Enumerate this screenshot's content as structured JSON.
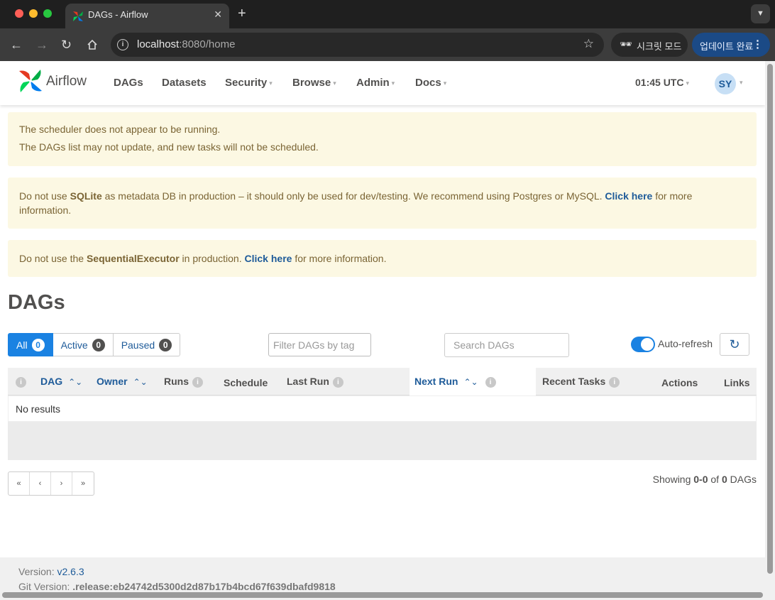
{
  "browser": {
    "tab_title": "DAGs - Airflow",
    "new_tab": "+",
    "tab_close": "✕",
    "url_host": "localhost",
    "url_rest": ":8080/home",
    "incognito_label": "시크릿 모드",
    "update_label": "업데이트 완료"
  },
  "navbar": {
    "brand": "Airflow",
    "menu": [
      {
        "label": "DAGs",
        "dropdown": false
      },
      {
        "label": "Datasets",
        "dropdown": false
      },
      {
        "label": "Security",
        "dropdown": true
      },
      {
        "label": "Browse",
        "dropdown": true
      },
      {
        "label": "Admin",
        "dropdown": true
      },
      {
        "label": "Docs",
        "dropdown": true
      }
    ],
    "time": "01:45 UTC",
    "avatar": "SY"
  },
  "alerts": {
    "scheduler_line1": "The scheduler does not appear to be running.",
    "scheduler_line2": "The DAGs list may not update, and new tasks will not be scheduled.",
    "sqlite_pre": "Do not use ",
    "sqlite_bold": "SQLite",
    "sqlite_mid": " as metadata DB in production – it should only be used for dev/testing. We recommend using Postgres or MySQL. ",
    "sqlite_link": "Click here",
    "sqlite_post": " for more information.",
    "executor_pre": "Do not use the ",
    "executor_bold": "SequentialExecutor",
    "executor_mid": " in production. ",
    "executor_link": "Click here",
    "executor_post": " for more information."
  },
  "dags": {
    "title": "DAGs",
    "filters": [
      {
        "label": "All",
        "count": "0"
      },
      {
        "label": "Active",
        "count": "0"
      },
      {
        "label": "Paused",
        "count": "0"
      }
    ],
    "tag_filter_placeholder": "Filter DAGs by tag",
    "search_placeholder": "Search DAGs",
    "auto_refresh_label": "Auto-refresh",
    "auto_refresh_on": true,
    "columns": {
      "dag": "DAG",
      "owner": "Owner",
      "runs": "Runs",
      "schedule": "Schedule",
      "last_run": "Last Run",
      "next_run": "Next Run",
      "recent_tasks": "Recent Tasks",
      "actions": "Actions",
      "links": "Links"
    },
    "empty_text": "No results",
    "pagination": [
      "«",
      "‹",
      "›",
      "»"
    ],
    "showing_pre": "Showing ",
    "showing_range": "0-0",
    "showing_mid": " of ",
    "showing_total": "0",
    "showing_post": " DAGs"
  },
  "footer": {
    "version_label": "Version: ",
    "version_value": "v2.6.3",
    "git_label": "Git Version: ",
    "git_value": ".release:eb24742d5300d2d87b17b4bcd67f639dbafd9818"
  },
  "colors": {
    "accent": "#1a82e2",
    "link": "#1e5b99",
    "alert_bg": "#fcf8e3",
    "alert_text": "#7a6434"
  }
}
